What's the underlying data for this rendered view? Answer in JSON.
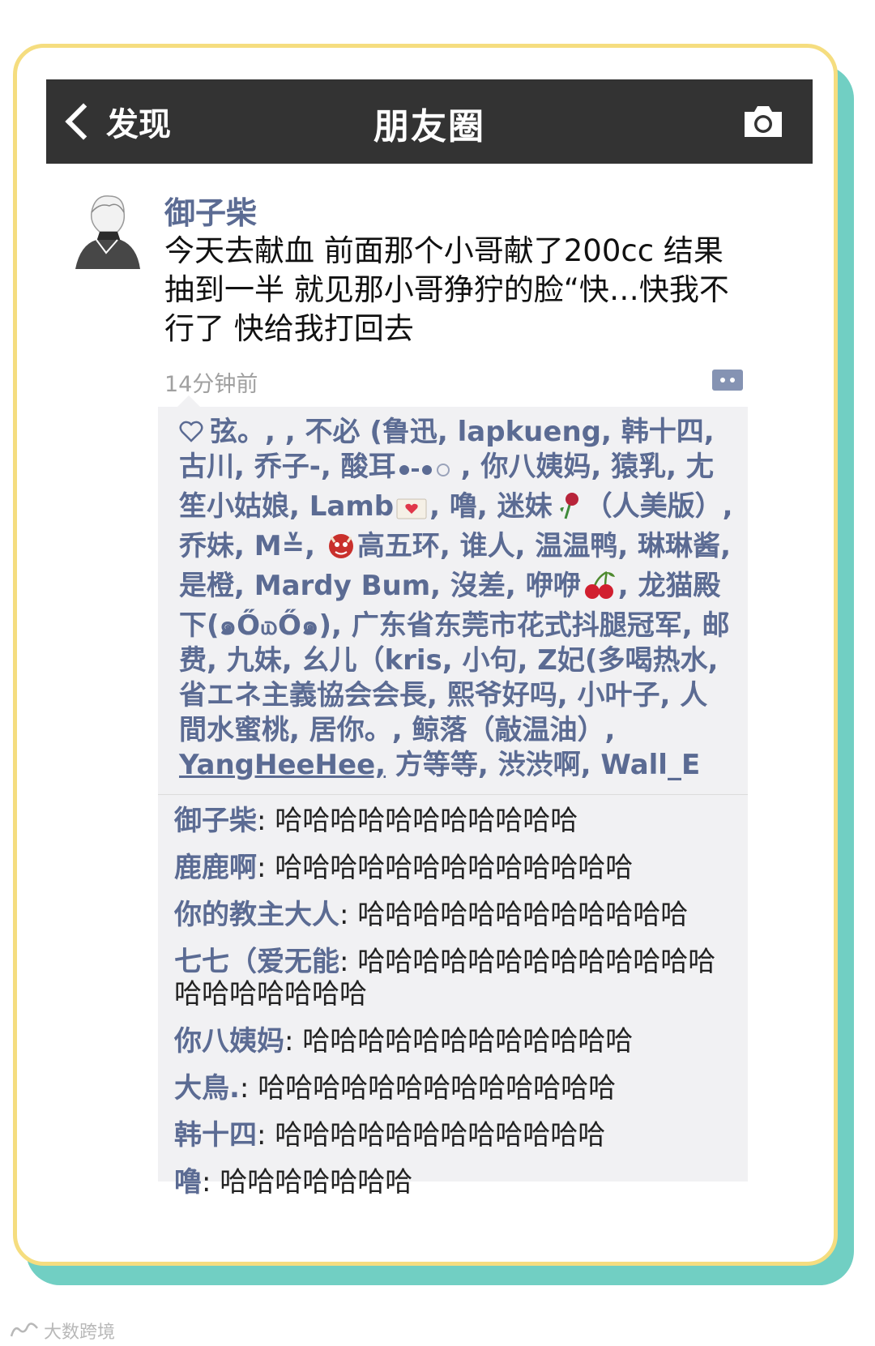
{
  "navbar": {
    "back_label": "发现",
    "title": "朋友圈"
  },
  "post": {
    "author": "御子柴",
    "text": "今天去献血 前面那个小哥献了200cc 结果抽到一半 就见那小哥狰狞的脸“快…快我不行了 快给我打回去",
    "timestamp": "14分钟前"
  },
  "likes": {
    "part1": "弦。, , 不必 (鲁迅, lapkueng, 韩十四, 古川, 乔子-, 酸耳",
    "part2": ", 你八姨妈, 猿乳, 尢笙小姑娘, Lamb",
    "part3": ", 噜, 迷妹",
    "part4": "（人美版）, 乔妹, M≚, ",
    "part5": "高五环, 谁人, 温温鸭, 琳琳酱, 是橙, Mardy Bum, 沒差, 咿咿",
    "part6": ", 龙猫殿下(๑Ő௰Ő๑), 广东省东莞市花式抖腿冠军, 邮费, 九妹, 幺儿（kris, 小句, Z妃(多喝热水, 省エネ主義協会会長, 熙爷好吗, 小叶子, 人間水蜜桃, 居你。, 鲸落（敲温油）, ",
    "underlined": " YangHeeHee,",
    "part7": " 方等等, 渋渋啊, Wall_E"
  },
  "comments": [
    {
      "name": "御子柴",
      "text": "哈哈哈哈哈哈哈哈哈哈哈"
    },
    {
      "name": "鹿鹿啊",
      "text": "哈哈哈哈哈哈哈哈哈哈哈哈哈"
    },
    {
      "name": "你的教主大人",
      "text": "哈哈哈哈哈哈哈哈哈哈哈哈"
    },
    {
      "name": "七七（爱无能",
      "text": "哈哈哈哈哈哈哈哈哈哈哈哈哈哈哈哈哈哈哈哈"
    },
    {
      "name": "你八姨妈",
      "text": "哈哈哈哈哈哈哈哈哈哈哈哈"
    },
    {
      "name": "大鳥.",
      "text": "哈哈哈哈哈哈哈哈哈哈哈哈哈"
    },
    {
      "name": "韩十四",
      "text": "哈哈哈哈哈哈哈哈哈哈哈哈"
    },
    {
      "name": "噜",
      "text": "哈哈哈哈哈哈哈"
    }
  ],
  "watermark": "大数跨境",
  "colors": {
    "navbar": "#333333",
    "name_link": "#5b6b93",
    "frame_border": "#f5dd7f",
    "frame_shadow": "#71cfc3"
  }
}
